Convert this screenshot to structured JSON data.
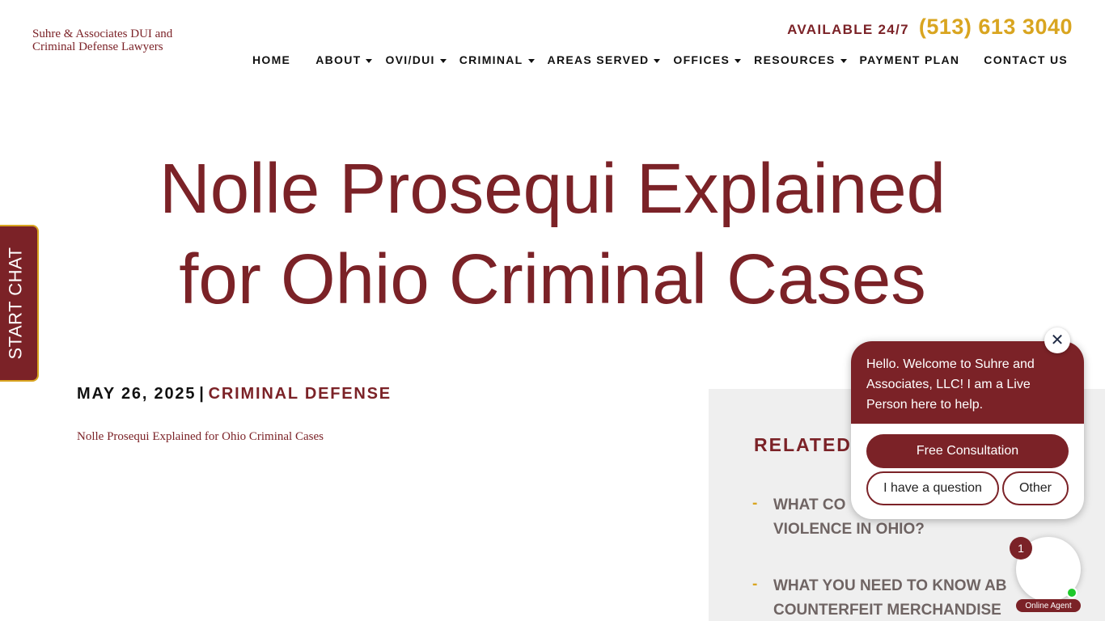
{
  "header": {
    "logo_alt": "Suhre & Associates DUI and Criminal Defense Lawyers",
    "available_label": "AVAILABLE 24/7",
    "phone": "(513) 613 3040"
  },
  "nav": [
    {
      "label": "HOME",
      "has_dropdown": false
    },
    {
      "label": "ABOUT",
      "has_dropdown": true
    },
    {
      "label": "OVI/DUI",
      "has_dropdown": true
    },
    {
      "label": "CRIMINAL",
      "has_dropdown": true
    },
    {
      "label": "AREAS SERVED",
      "has_dropdown": true
    },
    {
      "label": "OFFICES",
      "has_dropdown": true
    },
    {
      "label": "RESOURCES",
      "has_dropdown": true
    },
    {
      "label": "PAYMENT PLAN",
      "has_dropdown": false
    },
    {
      "label": "CONTACT US",
      "has_dropdown": false
    }
  ],
  "article": {
    "title_line1": "Nolle Prosequi Explained",
    "title_line2": "for Ohio Criminal Cases",
    "date": "MAY 26, 2025",
    "separator": "|",
    "category": "CRIMINAL DEFENSE",
    "image_alt": "Nolle Prosequi Explained for Ohio Criminal Cases"
  },
  "related": {
    "title": "RELATED",
    "items": [
      {
        "dash": "-",
        "line1": "WHAT CO",
        "line2": "VIOLENCE IN OHIO?"
      },
      {
        "dash": "-",
        "line1": "WHAT YOU NEED TO KNOW AB",
        "line2": "COUNTERFEIT MERCHANDISE"
      }
    ]
  },
  "chat": {
    "side_tab": "START CHAT",
    "message": "Hello. Welcome to Suhre and Associates, LLC! I am a Live Person here to help.",
    "btn_consult": "Free Consultation",
    "btn_question": "I have a question",
    "btn_other": "Other",
    "close_glyph": "✕",
    "badge_count": "1",
    "agent_label": "Online Agent"
  },
  "colors": {
    "brand": "#7b2227",
    "accent": "#d9a520",
    "online": "#1fc92b"
  }
}
